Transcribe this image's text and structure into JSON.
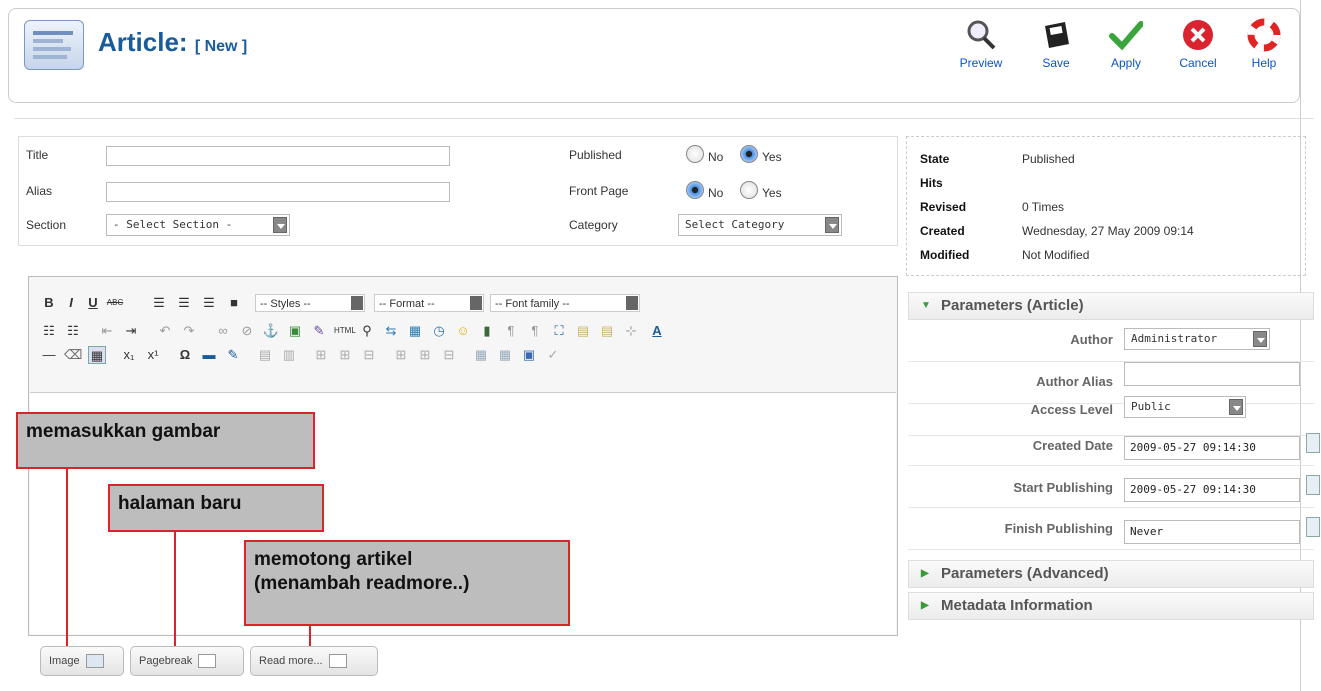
{
  "header": {
    "title": "Article:",
    "subtitle": "[ New ]",
    "toolbar": [
      {
        "label": "Preview",
        "icon": "magnifier-icon"
      },
      {
        "label": "Save",
        "icon": "save-icon"
      },
      {
        "label": "Apply",
        "icon": "checkmark-icon"
      },
      {
        "label": "Cancel",
        "icon": "cancel-icon"
      },
      {
        "label": "Help",
        "icon": "help-icon"
      }
    ]
  },
  "form": {
    "title_label": "Title",
    "alias_label": "Alias",
    "section_label": "Section",
    "section_value": "- Select Section -",
    "published_label": "Published",
    "frontpage_label": "Front Page",
    "category_label": "Category",
    "category_value": "Select Category",
    "no": "No",
    "yes": "Yes",
    "published": "Yes",
    "front_page": "No"
  },
  "editor": {
    "styles": "-- Styles --",
    "format": "-- Format --",
    "font_family": "-- Font family --",
    "buttons": [
      "Image",
      "Pagebreak",
      "Read more..."
    ]
  },
  "annotations": {
    "image": "memasukkan gambar",
    "pagebreak": "halaman baru",
    "readmore_line1": "memotong artikel",
    "readmore_line2": "(menambah readmore..)"
  },
  "info": {
    "state_k": "State",
    "state_v": "Published",
    "hits_k": "Hits",
    "revised_k": "Revised",
    "revised_v": "0 Times",
    "created_k": "Created",
    "created_v": "Wednesday, 27 May 2009 09:14",
    "modified_k": "Modified",
    "modified_v": "Not Modified"
  },
  "params": {
    "article_title": "Parameters (Article)",
    "author_label": "Author",
    "author_value": "Administrator",
    "author_alias_label": "Author Alias",
    "access_label": "Access Level",
    "access_value": "Public",
    "created_date_label": "Created Date",
    "created_date_value": "2009-05-27 09:14:30",
    "start_label": "Start Publishing",
    "start_value": "2009-05-27 09:14:30",
    "finish_label": "Finish Publishing",
    "finish_value": "Never",
    "advanced_title": "Parameters (Advanced)",
    "metadata_title": "Metadata Information"
  },
  "colors": {
    "title_blue": "#1a5c9b",
    "link_blue": "#0b55c4",
    "annotation_red": "#d6262b",
    "annotation_fill": "#bdbdbd"
  }
}
